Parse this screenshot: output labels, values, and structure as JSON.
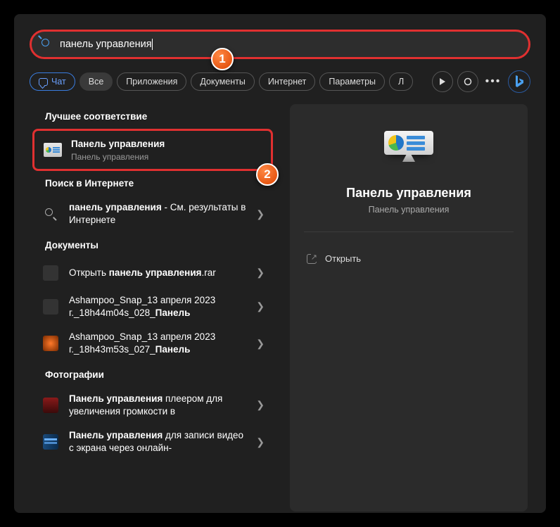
{
  "search": {
    "value": "панель управления"
  },
  "filters": {
    "chat": "Чат",
    "all": "Все",
    "apps": "Приложения",
    "docs": "Документы",
    "web": "Интернет",
    "params": "Параметры",
    "more_letter": "Л"
  },
  "badges": {
    "one": "1",
    "two": "2"
  },
  "sections": {
    "best": "Лучшее соответствие",
    "web": "Поиск в Интернете",
    "docs": "Документы",
    "photos": "Фотографии"
  },
  "best": {
    "title": "Панель управления",
    "sub": "Панель управления"
  },
  "web_result": {
    "prefix_bold": "панель управления",
    "suffix": " - См. результаты в Интернете"
  },
  "docs": {
    "d1": {
      "pre": "Открыть ",
      "bold": "панель управления",
      "post": ".rar"
    },
    "d2": {
      "line1": "Ashampoo_Snap_13 апреля 2023",
      "line2_pre": "г._18h44m04s_028_",
      "line2_bold": "Панель"
    },
    "d3": {
      "line1": "Ashampoo_Snap_13 апреля 2023",
      "line2_pre": "г._18h43m53s_027_",
      "line2_bold": "Панель"
    }
  },
  "photos": {
    "p1": {
      "bold": "Панель управления",
      "rest": " плеером для увеличения громкости в"
    },
    "p2": {
      "bold": "Панель управления",
      "rest": " для записи видео с экрана через онлайн-"
    }
  },
  "detail": {
    "title": "Панель управления",
    "sub": "Панель управления",
    "open": "Открыть"
  }
}
